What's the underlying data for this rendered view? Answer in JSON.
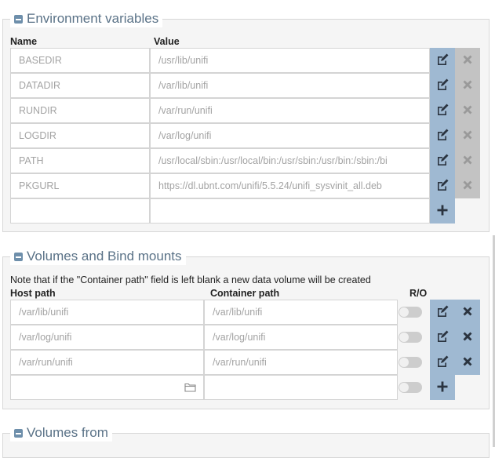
{
  "env": {
    "legend": "Environment variables",
    "name_header": "Name",
    "value_header": "Value",
    "rows": [
      {
        "name": "BASEDIR",
        "value": "/usr/lib/unifi"
      },
      {
        "name": "DATADIR",
        "value": "/var/lib/unifi"
      },
      {
        "name": "RUNDIR",
        "value": "/var/run/unifi"
      },
      {
        "name": "LOGDIR",
        "value": "/var/log/unifi"
      },
      {
        "name": "PATH",
        "value": "/usr/local/sbin:/usr/local/bin:/usr/sbin:/usr/bin:/sbin:/bi"
      },
      {
        "name": "PKGURL",
        "value": "https://dl.ubnt.com/unifi/5.5.24/unifi_sysvinit_all.deb"
      }
    ],
    "new_row": {
      "name": "",
      "value": ""
    }
  },
  "volumes": {
    "legend": "Volumes and Bind mounts",
    "note": "Note that if the \"Container path\" field is left blank a new data volume will be created",
    "host_header": "Host path",
    "container_header": "Container path",
    "ro_header": "R/O",
    "rows": [
      {
        "host": "/var/lib/unifi",
        "container": "/var/lib/unifi",
        "read_only": false
      },
      {
        "host": "/var/log/unifi",
        "container": "/var/log/unifi",
        "read_only": false
      },
      {
        "host": "/var/run/unifi",
        "container": "/var/run/unifi",
        "read_only": false
      }
    ],
    "new_row": {
      "host": "",
      "container": "",
      "read_only": false
    }
  },
  "volumes_from": {
    "legend": "Volumes from"
  },
  "colors": {
    "accent": "#9fb9d2",
    "disabled": "#c3c3c3",
    "icon_dark": "#2b3440",
    "icon_muted": "#9a9a9a",
    "legend_text": "#5a7287"
  },
  "icons": {
    "edit": "edit-icon",
    "delete": "close-icon",
    "add": "plus-icon",
    "browse": "folder-icon",
    "collapse": "minus-square-icon"
  }
}
